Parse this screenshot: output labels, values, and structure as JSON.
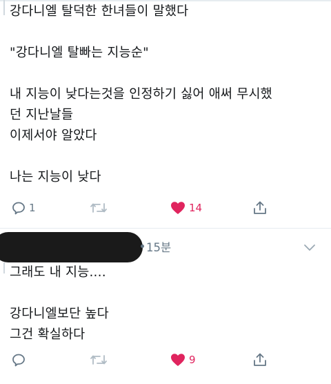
{
  "tweet1": {
    "text": "강다니엘 탈덕한 한녀들이 말했다\n\n\"강다니엘 탈빠는 지능순\"\n\n내 지능이 낮다는것을 인정하기 싫어 애써 무시했\n던 지난날들\n이제서야 알았다\n\n나는 지능이 낮다",
    "actions": {
      "reply_count": "1",
      "retweet_count": "",
      "like_count": "14"
    }
  },
  "tweet2": {
    "time": "15분",
    "text": "그래도 내 지능....\n\n강다니엘보단 높다\n그건 확실하다",
    "actions": {
      "reply_count": "",
      "retweet_count": "",
      "like_count": "9"
    }
  },
  "colors": {
    "like": "#e0245e",
    "icon": "#657786",
    "text": "#14171a"
  },
  "icons": [
    "reply-icon",
    "retweet-icon",
    "heart-icon",
    "share-icon",
    "chevron-down-icon"
  ]
}
